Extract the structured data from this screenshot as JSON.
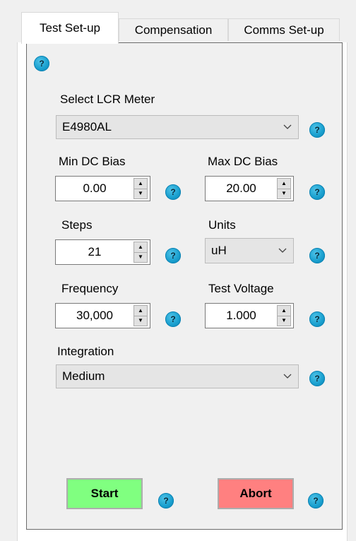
{
  "tabs": [
    {
      "label": "Test Set-up",
      "active": true
    },
    {
      "label": "Compensation",
      "active": false
    },
    {
      "label": "Comms Set-up",
      "active": false
    }
  ],
  "help_glyph": "?",
  "lcr": {
    "label": "Select LCR Meter",
    "value": "E4980AL"
  },
  "min_dc_bias": {
    "label": "Min DC Bias",
    "value": "0.00"
  },
  "max_dc_bias": {
    "label": "Max DC Bias",
    "value": "20.00"
  },
  "steps": {
    "label": "Steps",
    "value": "21"
  },
  "units": {
    "label": "Units",
    "value": "uH"
  },
  "frequency": {
    "label": "Frequency",
    "value": "30,000"
  },
  "test_voltage": {
    "label": "Test Voltage",
    "value": "1.000"
  },
  "integration": {
    "label": "Integration",
    "value": "Medium"
  },
  "buttons": {
    "start": "Start",
    "abort": "Abort"
  },
  "colors": {
    "start_bg": "#80ff80",
    "abort_bg": "#ff8080",
    "help": "#1aa0cf"
  }
}
